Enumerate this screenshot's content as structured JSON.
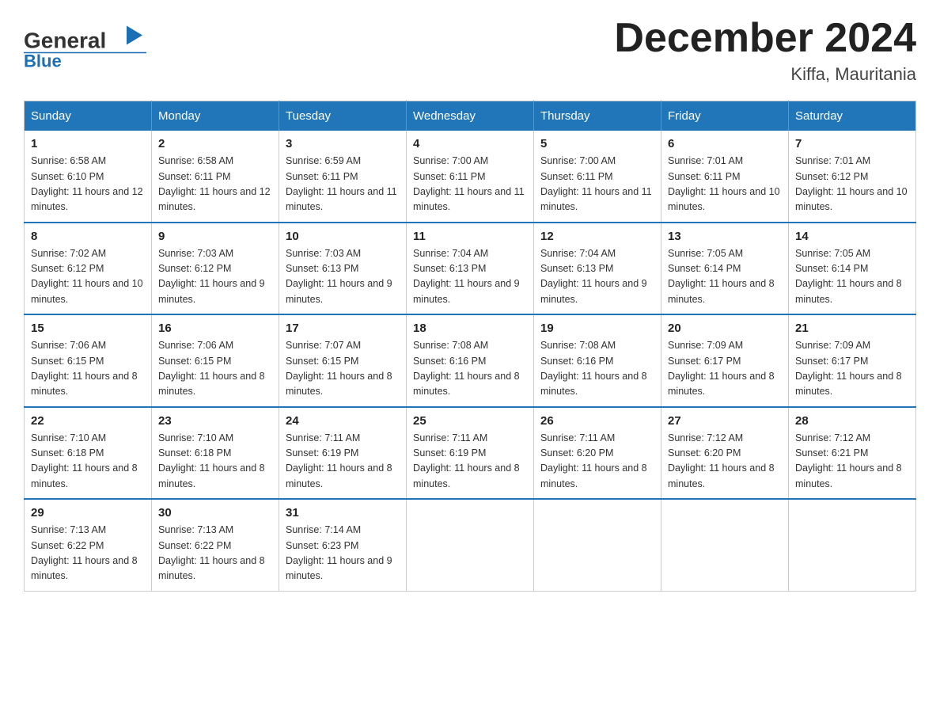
{
  "logo": {
    "text_general": "General",
    "text_blue": "Blue"
  },
  "title": {
    "month_year": "December 2024",
    "location": "Kiffa, Mauritania"
  },
  "weekdays": [
    "Sunday",
    "Monday",
    "Tuesday",
    "Wednesday",
    "Thursday",
    "Friday",
    "Saturday"
  ],
  "weeks": [
    [
      {
        "day": "1",
        "sunrise": "6:58 AM",
        "sunset": "6:10 PM",
        "daylight": "11 hours and 12 minutes."
      },
      {
        "day": "2",
        "sunrise": "6:58 AM",
        "sunset": "6:11 PM",
        "daylight": "11 hours and 12 minutes."
      },
      {
        "day": "3",
        "sunrise": "6:59 AM",
        "sunset": "6:11 PM",
        "daylight": "11 hours and 11 minutes."
      },
      {
        "day": "4",
        "sunrise": "7:00 AM",
        "sunset": "6:11 PM",
        "daylight": "11 hours and 11 minutes."
      },
      {
        "day": "5",
        "sunrise": "7:00 AM",
        "sunset": "6:11 PM",
        "daylight": "11 hours and 11 minutes."
      },
      {
        "day": "6",
        "sunrise": "7:01 AM",
        "sunset": "6:11 PM",
        "daylight": "11 hours and 10 minutes."
      },
      {
        "day": "7",
        "sunrise": "7:01 AM",
        "sunset": "6:12 PM",
        "daylight": "11 hours and 10 minutes."
      }
    ],
    [
      {
        "day": "8",
        "sunrise": "7:02 AM",
        "sunset": "6:12 PM",
        "daylight": "11 hours and 10 minutes."
      },
      {
        "day": "9",
        "sunrise": "7:03 AM",
        "sunset": "6:12 PM",
        "daylight": "11 hours and 9 minutes."
      },
      {
        "day": "10",
        "sunrise": "7:03 AM",
        "sunset": "6:13 PM",
        "daylight": "11 hours and 9 minutes."
      },
      {
        "day": "11",
        "sunrise": "7:04 AM",
        "sunset": "6:13 PM",
        "daylight": "11 hours and 9 minutes."
      },
      {
        "day": "12",
        "sunrise": "7:04 AM",
        "sunset": "6:13 PM",
        "daylight": "11 hours and 9 minutes."
      },
      {
        "day": "13",
        "sunrise": "7:05 AM",
        "sunset": "6:14 PM",
        "daylight": "11 hours and 8 minutes."
      },
      {
        "day": "14",
        "sunrise": "7:05 AM",
        "sunset": "6:14 PM",
        "daylight": "11 hours and 8 minutes."
      }
    ],
    [
      {
        "day": "15",
        "sunrise": "7:06 AM",
        "sunset": "6:15 PM",
        "daylight": "11 hours and 8 minutes."
      },
      {
        "day": "16",
        "sunrise": "7:06 AM",
        "sunset": "6:15 PM",
        "daylight": "11 hours and 8 minutes."
      },
      {
        "day": "17",
        "sunrise": "7:07 AM",
        "sunset": "6:15 PM",
        "daylight": "11 hours and 8 minutes."
      },
      {
        "day": "18",
        "sunrise": "7:08 AM",
        "sunset": "6:16 PM",
        "daylight": "11 hours and 8 minutes."
      },
      {
        "day": "19",
        "sunrise": "7:08 AM",
        "sunset": "6:16 PM",
        "daylight": "11 hours and 8 minutes."
      },
      {
        "day": "20",
        "sunrise": "7:09 AM",
        "sunset": "6:17 PM",
        "daylight": "11 hours and 8 minutes."
      },
      {
        "day": "21",
        "sunrise": "7:09 AM",
        "sunset": "6:17 PM",
        "daylight": "11 hours and 8 minutes."
      }
    ],
    [
      {
        "day": "22",
        "sunrise": "7:10 AM",
        "sunset": "6:18 PM",
        "daylight": "11 hours and 8 minutes."
      },
      {
        "day": "23",
        "sunrise": "7:10 AM",
        "sunset": "6:18 PM",
        "daylight": "11 hours and 8 minutes."
      },
      {
        "day": "24",
        "sunrise": "7:11 AM",
        "sunset": "6:19 PM",
        "daylight": "11 hours and 8 minutes."
      },
      {
        "day": "25",
        "sunrise": "7:11 AM",
        "sunset": "6:19 PM",
        "daylight": "11 hours and 8 minutes."
      },
      {
        "day": "26",
        "sunrise": "7:11 AM",
        "sunset": "6:20 PM",
        "daylight": "11 hours and 8 minutes."
      },
      {
        "day": "27",
        "sunrise": "7:12 AM",
        "sunset": "6:20 PM",
        "daylight": "11 hours and 8 minutes."
      },
      {
        "day": "28",
        "sunrise": "7:12 AM",
        "sunset": "6:21 PM",
        "daylight": "11 hours and 8 minutes."
      }
    ],
    [
      {
        "day": "29",
        "sunrise": "7:13 AM",
        "sunset": "6:22 PM",
        "daylight": "11 hours and 8 minutes."
      },
      {
        "day": "30",
        "sunrise": "7:13 AM",
        "sunset": "6:22 PM",
        "daylight": "11 hours and 8 minutes."
      },
      {
        "day": "31",
        "sunrise": "7:14 AM",
        "sunset": "6:23 PM",
        "daylight": "11 hours and 9 minutes."
      },
      null,
      null,
      null,
      null
    ]
  ],
  "labels": {
    "sunrise": "Sunrise: ",
    "sunset": "Sunset: ",
    "daylight": "Daylight: "
  }
}
